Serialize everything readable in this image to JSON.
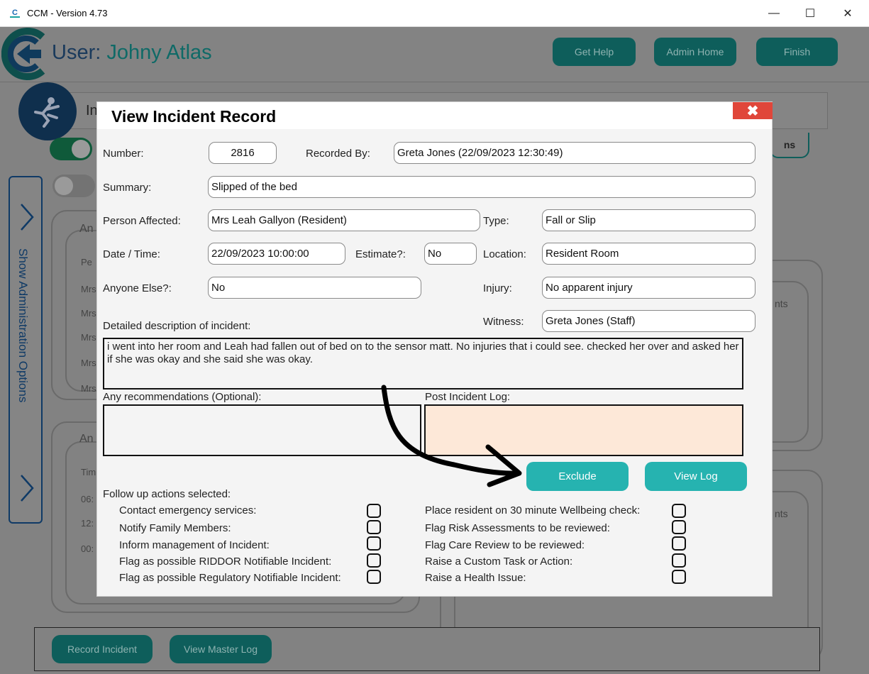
{
  "window": {
    "title": "CCM - Version 4.73",
    "minimize_glyph": "—",
    "maximize_glyph": "☐",
    "close_glyph": "✕"
  },
  "header": {
    "user_prefix": "User:",
    "user_name": "Johny Atlas",
    "buttons": {
      "help": "Get Help",
      "admin": "Admin Home",
      "finish": "Finish"
    }
  },
  "background": {
    "incident_bar_partial": "In",
    "side_tab_label": "Show Administration Options",
    "right_partial_button": "ns",
    "panel_a_title": "An",
    "panel_a_header": "Pe",
    "panel_a_rows": [
      "Mrs",
      "Mrs",
      "Mrs",
      "Mrs",
      "Mrs"
    ],
    "panel_b_title": "An",
    "panel_b_header": "Tim",
    "panel_b_rows": [
      "06:",
      "12:",
      "00:"
    ],
    "right_panel_label_1": "nts",
    "right_panel_label_2": "nts",
    "bottom_buttons": {
      "record": "Record Incident",
      "master_log": "View Master Log"
    }
  },
  "modal": {
    "title": "View Incident Record",
    "close_glyph": "✖",
    "labels": {
      "number": "Number:",
      "recorded_by": "Recorded By:",
      "summary": "Summary:",
      "person_affected": "Person Affected:",
      "type": "Type:",
      "date_time": "Date / Time:",
      "estimate": "Estimate?:",
      "location": "Location:",
      "anyone_else": "Anyone Else?:",
      "injury": "Injury:",
      "witness": "Witness:",
      "detailed_description": "Detailed description of incident:",
      "recommendations": "Any recommendations (Optional):",
      "post_incident_log": "Post Incident Log:",
      "follow_up": "Follow up actions selected:"
    },
    "values": {
      "number": "2816",
      "recorded_by": "Greta Jones (22/09/2023 12:30:49)",
      "summary": "Slipped of the bed",
      "person_affected": "Mrs Leah Gallyon (Resident)",
      "type": "Fall or Slip",
      "date_time": "22/09/2023 10:00:00",
      "estimate": "No",
      "location": "Resident Room",
      "anyone_else": "No",
      "injury": "No apparent injury",
      "witness": "Greta Jones (Staff)",
      "detailed_description": "i went into her room and Leah had fallen out of bed on to the sensor matt. No injuries that i could see. checked her over and asked her if she was okay and she said she was okay.",
      "recommendations": "",
      "post_incident_log": ""
    },
    "buttons": {
      "exclude": "Exclude",
      "view_log": "View Log"
    },
    "follow_up_left": [
      {
        "label": "Contact emergency services:",
        "checked": false
      },
      {
        "label": "Notify Family Members:",
        "checked": false
      },
      {
        "label": "Inform management of Incident:",
        "checked": false
      },
      {
        "label": "Flag as possible RIDDOR Notifiable Incident:",
        "checked": false
      },
      {
        "label": "Flag as possible Regulatory Notifiable Incident:",
        "checked": false
      }
    ],
    "follow_up_right": [
      {
        "label": "Place resident on 30 minute Wellbeing check:",
        "checked": false
      },
      {
        "label": "Flag Risk Assessments to be reviewed:",
        "checked": false
      },
      {
        "label": "Flag Care Review to be reviewed:",
        "checked": false
      },
      {
        "label": "Raise a Custom Task or Action:",
        "checked": false
      },
      {
        "label": "Raise a Health Issue:",
        "checked": false
      }
    ]
  },
  "colors": {
    "teal_button": "#26b3b0",
    "dark_teal": "#0e5e5b",
    "close_red": "#e0463a",
    "peach": "#fde8d8",
    "navy": "#0f3a66"
  }
}
